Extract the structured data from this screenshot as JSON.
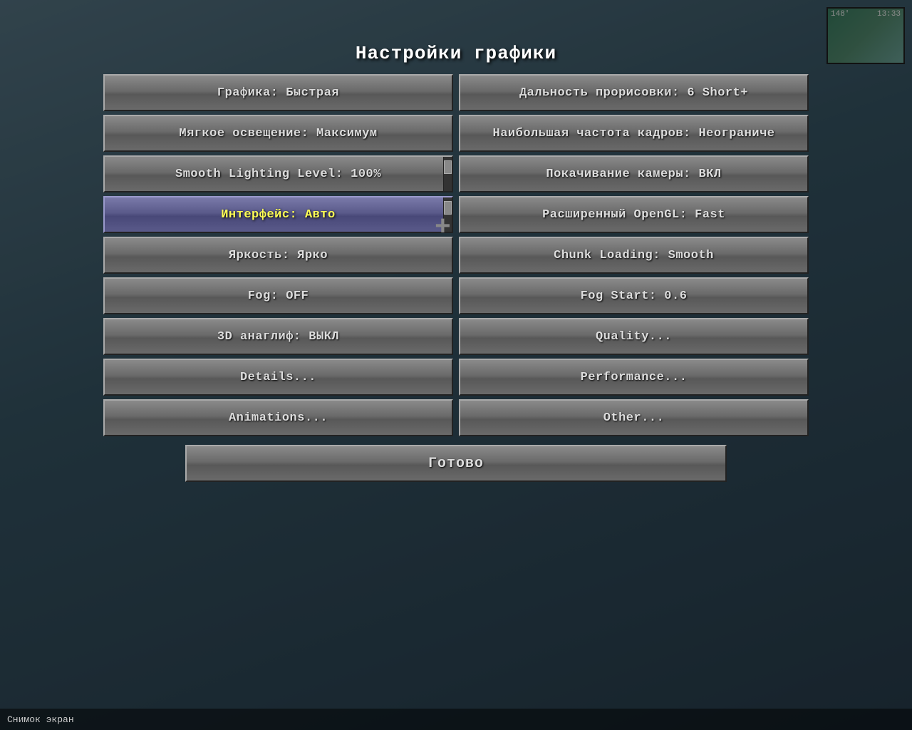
{
  "title": "Настройки графики",
  "minimap": {
    "coords": "148'",
    "time": "13:33"
  },
  "buttons": {
    "left": [
      {
        "id": "graphics-preset",
        "label": "Графика: Быстрая",
        "active": false
      },
      {
        "id": "smooth-lighting",
        "label": "Мягкое освещение: Максимум",
        "active": false
      },
      {
        "id": "smooth-lighting-level",
        "label": "Smooth Lighting Level: 100%",
        "active": false
      },
      {
        "id": "interface",
        "label": "Интерфейс: Авто",
        "active": true
      },
      {
        "id": "brightness",
        "label": "Яркость: Ярко",
        "active": false
      },
      {
        "id": "fog",
        "label": "Fog: OFF",
        "active": false
      },
      {
        "id": "anaglyph-3d",
        "label": "3D анаглиф: ВЫКЛ",
        "active": false
      },
      {
        "id": "details",
        "label": "Details...",
        "active": false
      },
      {
        "id": "animations",
        "label": "Animations...",
        "active": false
      }
    ],
    "right": [
      {
        "id": "render-distance",
        "label": "Дальность прорисовки: 6 Short+",
        "active": false
      },
      {
        "id": "max-framerate",
        "label": "Наибольшая частота кадров: Неограниче",
        "active": false
      },
      {
        "id": "camera-bob",
        "label": "Покачивание камеры: ВКЛ",
        "active": false
      },
      {
        "id": "advanced-opengl",
        "label": "Расширенный OpenGL: Fast",
        "active": false
      },
      {
        "id": "chunk-loading",
        "label": "Chunk Loading: Smooth",
        "active": false
      },
      {
        "id": "fog-start",
        "label": "Fog Start: 0.6",
        "active": false
      },
      {
        "id": "quality",
        "label": "Quality...",
        "active": false
      },
      {
        "id": "performance",
        "label": "Performance...",
        "active": false
      },
      {
        "id": "other",
        "label": "Other...",
        "active": false
      }
    ],
    "done": "Готово"
  },
  "bottombar": {
    "text": "Снимок экран"
  }
}
